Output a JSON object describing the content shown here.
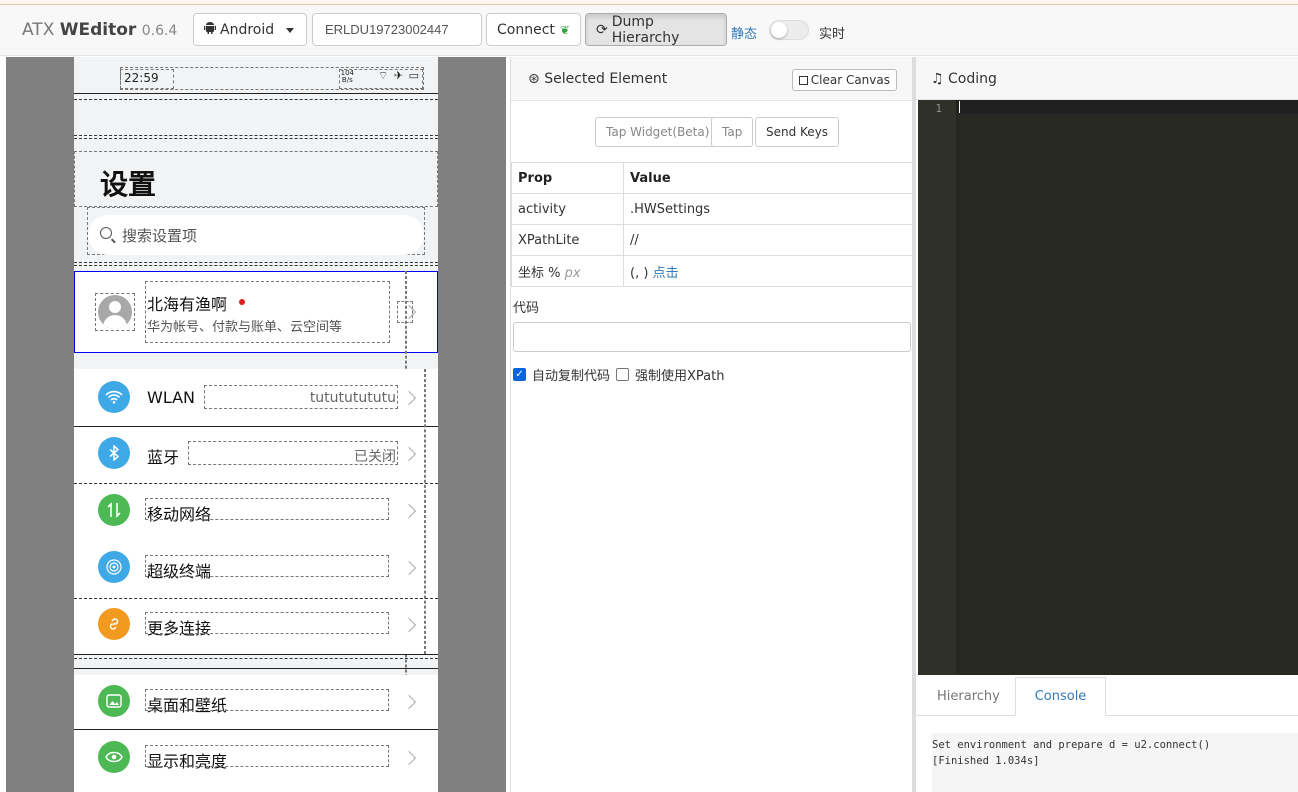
{
  "header": {
    "brand_prefix": "ATX ",
    "brand_name": "WEditor",
    "version": "0.6.4",
    "platform_select": "Android",
    "serial_value": "ERLDU19723002447",
    "connect_label": "Connect",
    "dump_label": "Dump Hierarchy",
    "mode_static": "静态",
    "mode_live": "实时"
  },
  "phone": {
    "time": "22:59",
    "net_speed_top": "104",
    "net_speed_bottom": "B/s",
    "sys_icons": "⌔ ✈ ▭",
    "page_title": "设置",
    "search_placeholder": "搜索设置项",
    "account": {
      "name": "北海有渔啊",
      "subtitle": "华为帐号、付款与账单、云空间等"
    },
    "group1": [
      {
        "label": "WLAN",
        "value": "tutututututu",
        "icon": "wifi-icon",
        "color": "#3fa9e8"
      },
      {
        "label": "蓝牙",
        "value": "已关闭",
        "icon": "bluetooth-icon",
        "color": "#3fa9e8"
      },
      {
        "label": "移动网络",
        "value": "",
        "icon": "mobile-network-icon",
        "color": "#4cb954"
      },
      {
        "label": "超级终端",
        "value": "",
        "icon": "super-device-icon",
        "color": "#3fa9e8"
      },
      {
        "label": "更多连接",
        "value": "",
        "icon": "link-icon",
        "color": "#f29a1f"
      }
    ],
    "group2": [
      {
        "label": "桌面和壁纸",
        "icon": "wallpaper-icon",
        "color": "#4cb954"
      },
      {
        "label": "显示和亮度",
        "icon": "eye-icon",
        "color": "#4cb954"
      }
    ]
  },
  "inspector": {
    "title": "Selected Element",
    "clear_canvas": "Clear Canvas",
    "tap_widget": "Tap Widget(Beta)",
    "tap": "Tap",
    "send_keys": "Send Keys",
    "col_prop": "Prop",
    "col_value": "Value",
    "rows": [
      {
        "prop": "activity",
        "value": ".HWSettings"
      },
      {
        "prop": "XPathLite",
        "value": "//"
      }
    ],
    "coord_label": "坐标 %",
    "coord_px": "px",
    "coord_value": "(, )",
    "coord_click": "点击",
    "code_label": "代码",
    "auto_copy": "自动复制代码",
    "force_xpath": "强制使用XPath"
  },
  "coding": {
    "title": "Coding",
    "line_number": "1",
    "tab_hierarchy": "Hierarchy",
    "tab_console": "Console",
    "console_text": "Set environment and prepare d = u2.connect()\n[Finished 1.034s]"
  }
}
